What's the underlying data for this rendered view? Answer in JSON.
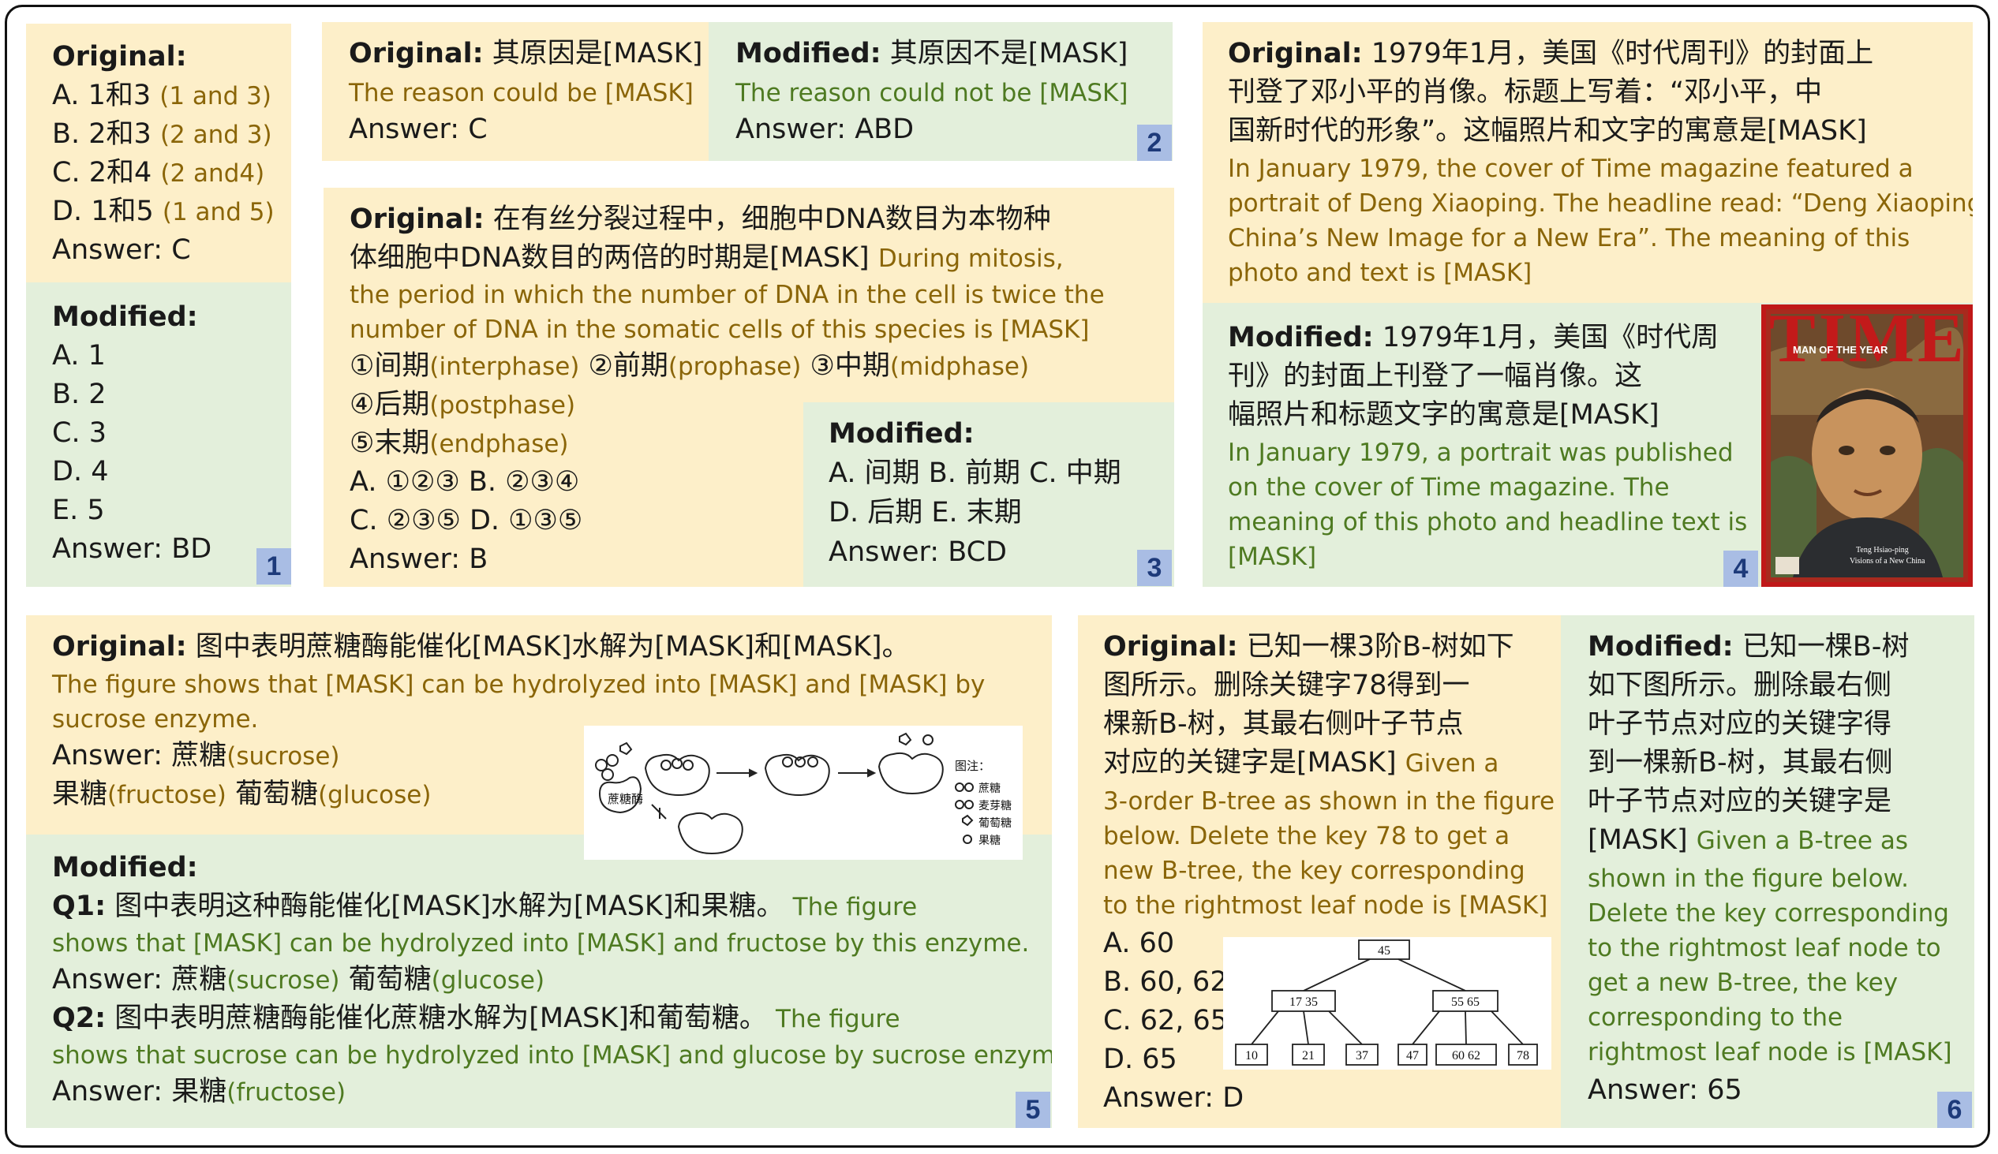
{
  "p1": {
    "orig_head": "Original:",
    "orig_lines": [
      {
        "zh": "A. 1和3",
        "en": "(1 and 3)"
      },
      {
        "zh": "B. 2和3",
        "en": "(2 and 3)"
      },
      {
        "zh": "C. 2和4",
        "en": "(2 and4)"
      },
      {
        "zh": "D. 1和5",
        "en": "(1 and 5)"
      }
    ],
    "orig_answer": "Answer: C",
    "mod_head": "Modified:",
    "mod_lines": [
      "A. 1",
      "B. 2",
      "C. 3",
      "D. 4",
      "E. 5"
    ],
    "mod_answer": "Answer: BD",
    "num": "1"
  },
  "p2": {
    "orig_head": "Original:",
    "orig_zh": "其原因是[MASK]",
    "orig_en": "The reason could be [MASK]",
    "orig_answer": "Answer: C",
    "mod_head": "Modified:",
    "mod_zh": "其原因不是[MASK]",
    "mod_en": "The reason could not be [MASK]",
    "mod_answer": "Answer: ABD",
    "num": "2"
  },
  "p3": {
    "orig_head": "Original:",
    "zh1": "在有丝分裂过程中，细胞中DNA数目为本物种",
    "zh2": "体细胞中DNA数目的两倍的时期是[MASK]",
    "en1": "During mitosis,",
    "en2": "the period in which the number of DNA in the cell is twice the",
    "en3": "number of DNA in the somatic cells of this species is [MASK]",
    "phases": [
      {
        "zh": "①间期",
        "en": "(interphase)"
      },
      {
        "zh": "②前期",
        "en": "(prophase)"
      },
      {
        "zh": "③中期",
        "en": "(midphase)"
      },
      {
        "zh": "④后期",
        "en": "(postphase)"
      },
      {
        "zh": "⑤末期",
        "en": "(endphase)"
      }
    ],
    "opt1": "A. ①②③  B. ②③④",
    "opt2": "C. ②③⑤  D. ①③⑤",
    "orig_answer": "Answer: B",
    "mod_head": "Modified:",
    "mod1": "A. 间期 B. 前期  C. 中期",
    "mod2": "D. 后期 E. 末期",
    "mod_answer": "Answer: BCD",
    "num": "3"
  },
  "p4": {
    "orig_head": "Original:",
    "zh1": "1979年1月，美国《时代周刊》的封面上",
    "zh2": "刊登了邓小平的肖像。标题上写着：“邓小平，中",
    "zh3": "国新时代的形象”。这幅照片和文字的寓意是[MASK]",
    "en": [
      "In January 1979, the cover of Time magazine featured a",
      "portrait of Deng Xiaoping. The headline read: “Deng Xiaoping,",
      "China’s New Image for a New Era”. The meaning of this",
      "photo and text is [MASK]"
    ],
    "mod_head": "Modified:",
    "mzh1": "1979年1月，美国《时代周",
    "mzh2": "刊》的封面上刊登了一幅肖像。这",
    "mzh3": "幅照片和标题文字的寓意是[MASK]",
    "men": [
      "In January 1979, a portrait was published",
      "on the cover of Time magazine. The",
      "meaning of this photo and headline text is",
      "[MASK]"
    ],
    "cover_title": "TIME",
    "cover_banner": "MAN OF THE YEAR",
    "cover_cap1": "Teng Hsiao-ping",
    "cover_cap2": "Visions of a New China",
    "num": "4"
  },
  "p5": {
    "orig_head": "Original:",
    "orig_zh": "图中表明蔗糖酶能催化[MASK]水解为[MASK]和[MASK]。",
    "en1": "The figure shows that [MASK] can be hydrolyzed into [MASK] and [MASK] by",
    "en2": "sucrose enzyme.",
    "ans1_zh": "Answer: 蔗糖",
    "ans1_en": "(sucrose)",
    "ans2_zh1": "果糖",
    "ans2_en1": "(fructose)",
    "ans2_zh2": "葡萄糖",
    "ans2_en2": "(glucose)",
    "fig_enzyme": "蔗糖酶",
    "legend_title": "图注：",
    "legend": [
      "蔗糖",
      "麦芽糖",
      "葡萄糖",
      "果糖"
    ],
    "mod_head": "Modified:",
    "q1_head": "Q1:",
    "q1_zh": "图中表明这种酶能催化[MASK]水解为[MASK]和果糖。",
    "q1_en1": "The figure",
    "q1_en2": "shows that [MASK] can be hydrolyzed into [MASK] and fructose by this enzyme.",
    "q1_ans_zh1": "Answer: 蔗糖",
    "q1_ans_en1": "(sucrose)",
    "q1_ans_zh2": "葡萄糖",
    "q1_ans_en2": "(glucose)",
    "q2_head": "Q2:",
    "q2_zh": "图中表明蔗糖酶能催化蔗糖水解为[MASK]和葡萄糖。",
    "q2_en1": "The figure",
    "q2_en2": "shows that sucrose can be hydrolyzed into [MASK] and glucose by sucrose enzyme.",
    "q2_ans_zh": "Answer: 果糖",
    "q2_ans_en": "(fructose)",
    "num": "5"
  },
  "p6": {
    "orig_head": "Original:",
    "zh": [
      "已知一棵3阶B-树如下",
      "图所示。删除关键字78得到一",
      "棵新B-树，其最右侧叶子节点",
      "对应的关键字是[MASK]"
    ],
    "en0": "Given a",
    "en": [
      "3-order B-tree as shown in the figure",
      "below. Delete the key 78 to get a",
      "new B-tree, the key corresponding",
      "to the rightmost leaf node is [MASK]"
    ],
    "opts": [
      "A. 60",
      "B. 60, 62",
      "C. 62, 65",
      "D. 65"
    ],
    "orig_answer": "Answer: D",
    "tree": {
      "root": "45",
      "left": "17 35",
      "right": "55 65",
      "leaves": [
        "10",
        "21",
        "37",
        "47",
        "60 62",
        "78"
      ]
    },
    "mod_head": "Modified:",
    "mzh": [
      "已知一棵B-树",
      "如下图所示。删除最右侧",
      "叶子节点对应的关键字得",
      "到一棵新B-树，其最右侧",
      "叶子节点对应的关键字是"
    ],
    "mzh_last": "[MASK]",
    "men0": "Given a B-tree as",
    "men": [
      "shown in the figure below.",
      "Delete the key corresponding",
      "to the rightmost leaf node to",
      "get a new B-tree, the key",
      "corresponding to the",
      "rightmost leaf node is [MASK]"
    ],
    "mod_answer": "Answer: 65",
    "num": "6"
  }
}
